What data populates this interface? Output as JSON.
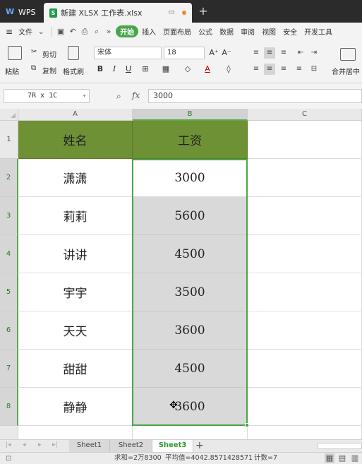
{
  "titlebar": {
    "app_tab": "WPS",
    "doc_tab": "新建 XLSX 工作表.xlsx",
    "new_tab": "+"
  },
  "menubar": {
    "file": "文件",
    "more": "»",
    "items": [
      "开始",
      "插入",
      "页面布局",
      "公式",
      "数据",
      "审阅",
      "视图",
      "安全",
      "开发工具"
    ],
    "active": "开始"
  },
  "ribbon": {
    "paste": "粘贴",
    "cut": "剪切",
    "copy": "复制",
    "format_painter": "格式刷",
    "font_name": "宋体",
    "font_size": "18",
    "merge_center": "合并居中"
  },
  "formula_bar": {
    "name_box": "7R x 1C",
    "fx": "fx",
    "value": "3000"
  },
  "columns": [
    "A",
    "B",
    "C"
  ],
  "rows": [
    {
      "num": "1",
      "name": "姓名",
      "salary": "工资"
    },
    {
      "num": "2",
      "name": "潇潇",
      "salary": "3000"
    },
    {
      "num": "3",
      "name": "莉莉",
      "salary": "5600"
    },
    {
      "num": "4",
      "name": "讲讲",
      "salary": "4500"
    },
    {
      "num": "5",
      "name": "宇宇",
      "salary": "3500"
    },
    {
      "num": "6",
      "name": "天天",
      "salary": "3600"
    },
    {
      "num": "7",
      "name": "甜甜",
      "salary": "4500"
    },
    {
      "num": "8",
      "name": "静静",
      "salary": "3600"
    }
  ],
  "sheets": [
    "Sheet1",
    "Sheet2",
    "Sheet3"
  ],
  "active_sheet": "Sheet3",
  "status": {
    "sum": "求和=2万8300",
    "average": "平均值=4042.8571428571",
    "count": "计数=7"
  },
  "colors": {
    "header_fill": "#6f9136",
    "accent": "#4aa54a"
  }
}
